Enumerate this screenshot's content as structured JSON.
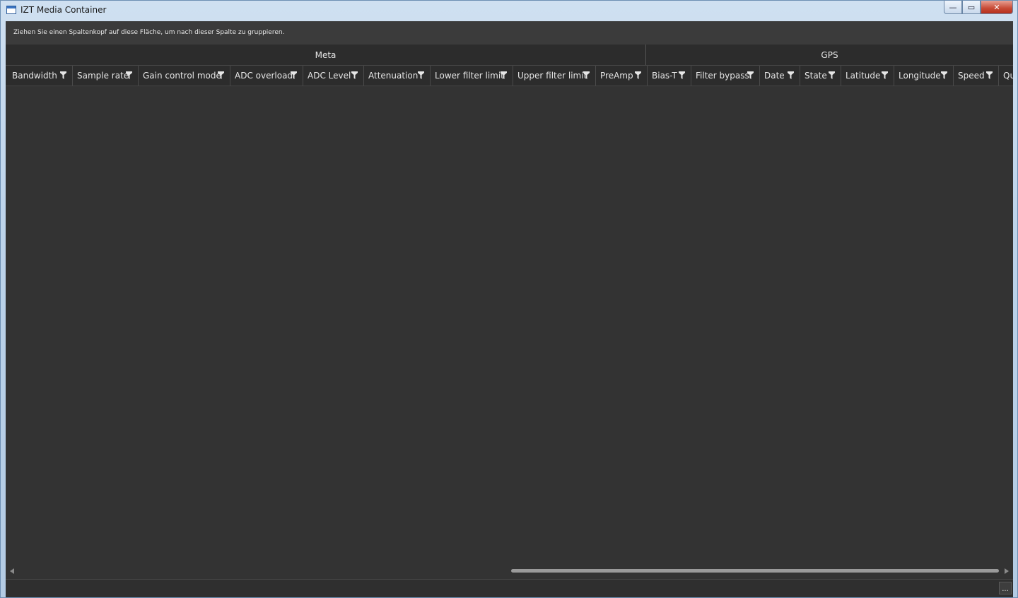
{
  "window": {
    "title": "IZT Media Container",
    "min_glyph": "—",
    "max_glyph": "▭",
    "close_glyph": "✕"
  },
  "group_panel": {
    "hint": "Ziehen Sie einen Spaltenkopf auf diese Fläche, um nach dieser Spalte zu gruppieren."
  },
  "column_groups": [
    {
      "label": "Meta"
    },
    {
      "label": "GPS"
    }
  ],
  "columns": [
    {
      "label": "Bandwidth",
      "icon": "filter-icon"
    },
    {
      "label": "Sample rate",
      "icon": "filter-icon"
    },
    {
      "label": "Gain control mode",
      "icon": "filter-icon"
    },
    {
      "label": "ADC overload",
      "icon": "filter-icon"
    },
    {
      "label": "ADC Level",
      "icon": "filter-icon"
    },
    {
      "label": "Attenuation",
      "icon": "filter-icon"
    },
    {
      "label": "Lower filter limit",
      "icon": "filter-icon"
    },
    {
      "label": "Upper filter limit",
      "icon": "filter-icon"
    },
    {
      "label": "PreAmp",
      "icon": "filter-icon"
    },
    {
      "label": "Bias-T",
      "icon": "filter-icon"
    },
    {
      "label": "Filter bypass",
      "icon": "filter-icon"
    },
    {
      "label": "Date",
      "icon": "filter-icon"
    },
    {
      "label": "State",
      "icon": "filter-icon"
    },
    {
      "label": "Latitude",
      "icon": "filter-icon"
    },
    {
      "label": "Longitude",
      "icon": "filter-icon"
    },
    {
      "label": "Speed",
      "icon": "filter-icon"
    },
    {
      "label": "Qu",
      "icon": "filter-icon"
    }
  ],
  "statusbar": {
    "button_label": "..."
  },
  "colors": {
    "grid_bg": "#333333",
    "header_bg": "#2c2c2c",
    "text": "#e6e6e6"
  }
}
